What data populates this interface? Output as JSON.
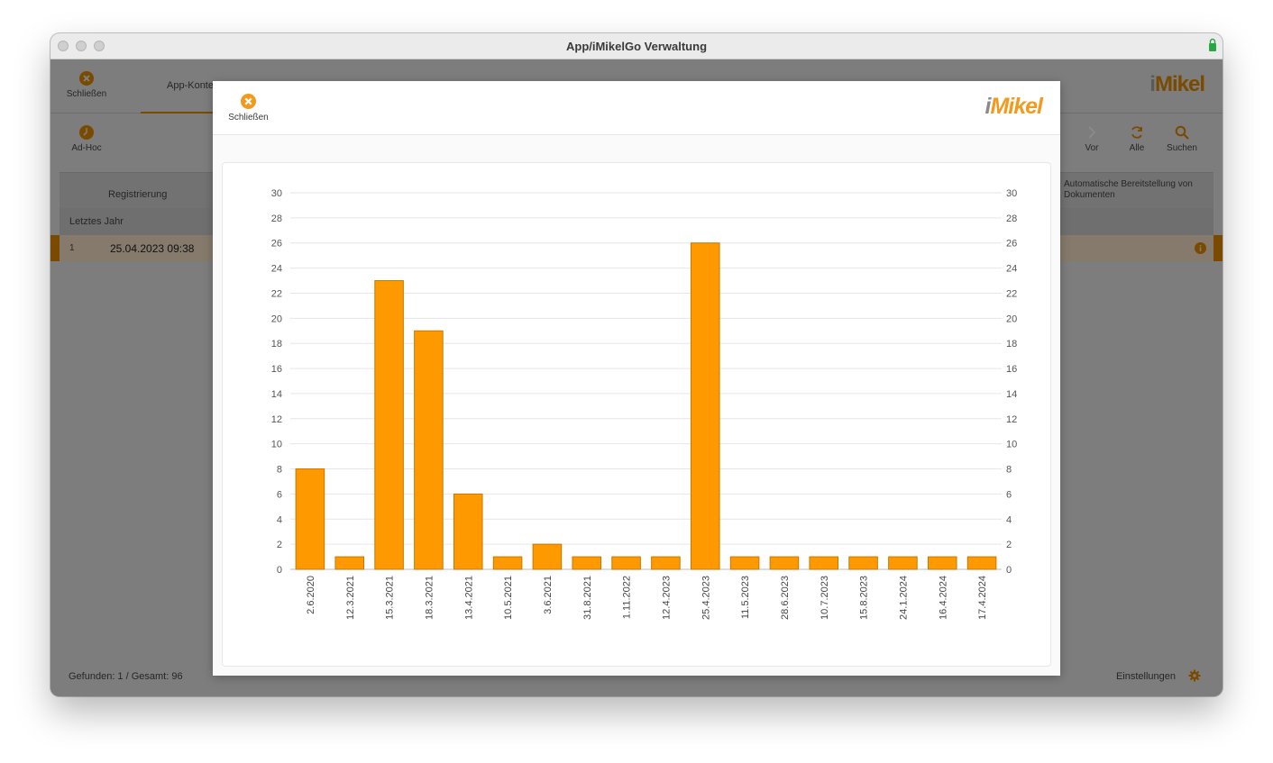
{
  "window": {
    "title": "App/iMikelGo Verwaltung"
  },
  "background": {
    "close_label": "Schließen",
    "tab_label": "App-Konte",
    "logo_i": "i",
    "logo_rest": "Mikel",
    "adhoc_label": "Ad-Hoc",
    "nav_next_label": "Vor",
    "nav_all_label": "Alle",
    "nav_search_label": "Suchen",
    "column_registration": "Registrierung",
    "column_auto_docs": "Automatische Bereitstellung von Dokumenten",
    "group_label": "Letztes Jahr",
    "row_index": "1",
    "row_datetime": "25.04.2023 09:38",
    "footer_found": "Gefunden: 1 / Gesamt: 96",
    "footer_settings": "Einstellungen"
  },
  "modal": {
    "close_label": "Schließen",
    "logo_i": "i",
    "logo_rest": "Mikel"
  },
  "colors": {
    "bar_fill": "#ff9900",
    "bar_stroke": "#c87800",
    "accent": "#f39a1e"
  },
  "icons": {
    "close": "close-circle-icon",
    "adhoc": "clock-icon",
    "next": "chevron-right-icon",
    "all": "refresh-icon",
    "search": "search-icon",
    "info": "info-icon",
    "settings": "gear-icon"
  },
  "chart_data": {
    "type": "bar",
    "categories": [
      "2.6.2020",
      "12.3.2021",
      "15.3.2021",
      "18.3.2021",
      "13.4.2021",
      "10.5.2021",
      "3.6.2021",
      "31.8.2021",
      "1.11.2022",
      "12.4.2023",
      "25.4.2023",
      "11.5.2023",
      "28.6.2023",
      "10.7.2023",
      "15.8.2023",
      "24.1.2024",
      "16.4.2024",
      "17.4.2024"
    ],
    "values": [
      8,
      1,
      23,
      19,
      6,
      1,
      2,
      1,
      1,
      1,
      26,
      1,
      1,
      1,
      1,
      1,
      1,
      1
    ],
    "ylim": [
      0,
      30
    ],
    "yticks": [
      0,
      2,
      4,
      6,
      8,
      10,
      12,
      14,
      16,
      18,
      20,
      22,
      24,
      26,
      28,
      30
    ],
    "grid": true,
    "dual_y_axis": true,
    "title": "",
    "xlabel": "",
    "ylabel": ""
  }
}
